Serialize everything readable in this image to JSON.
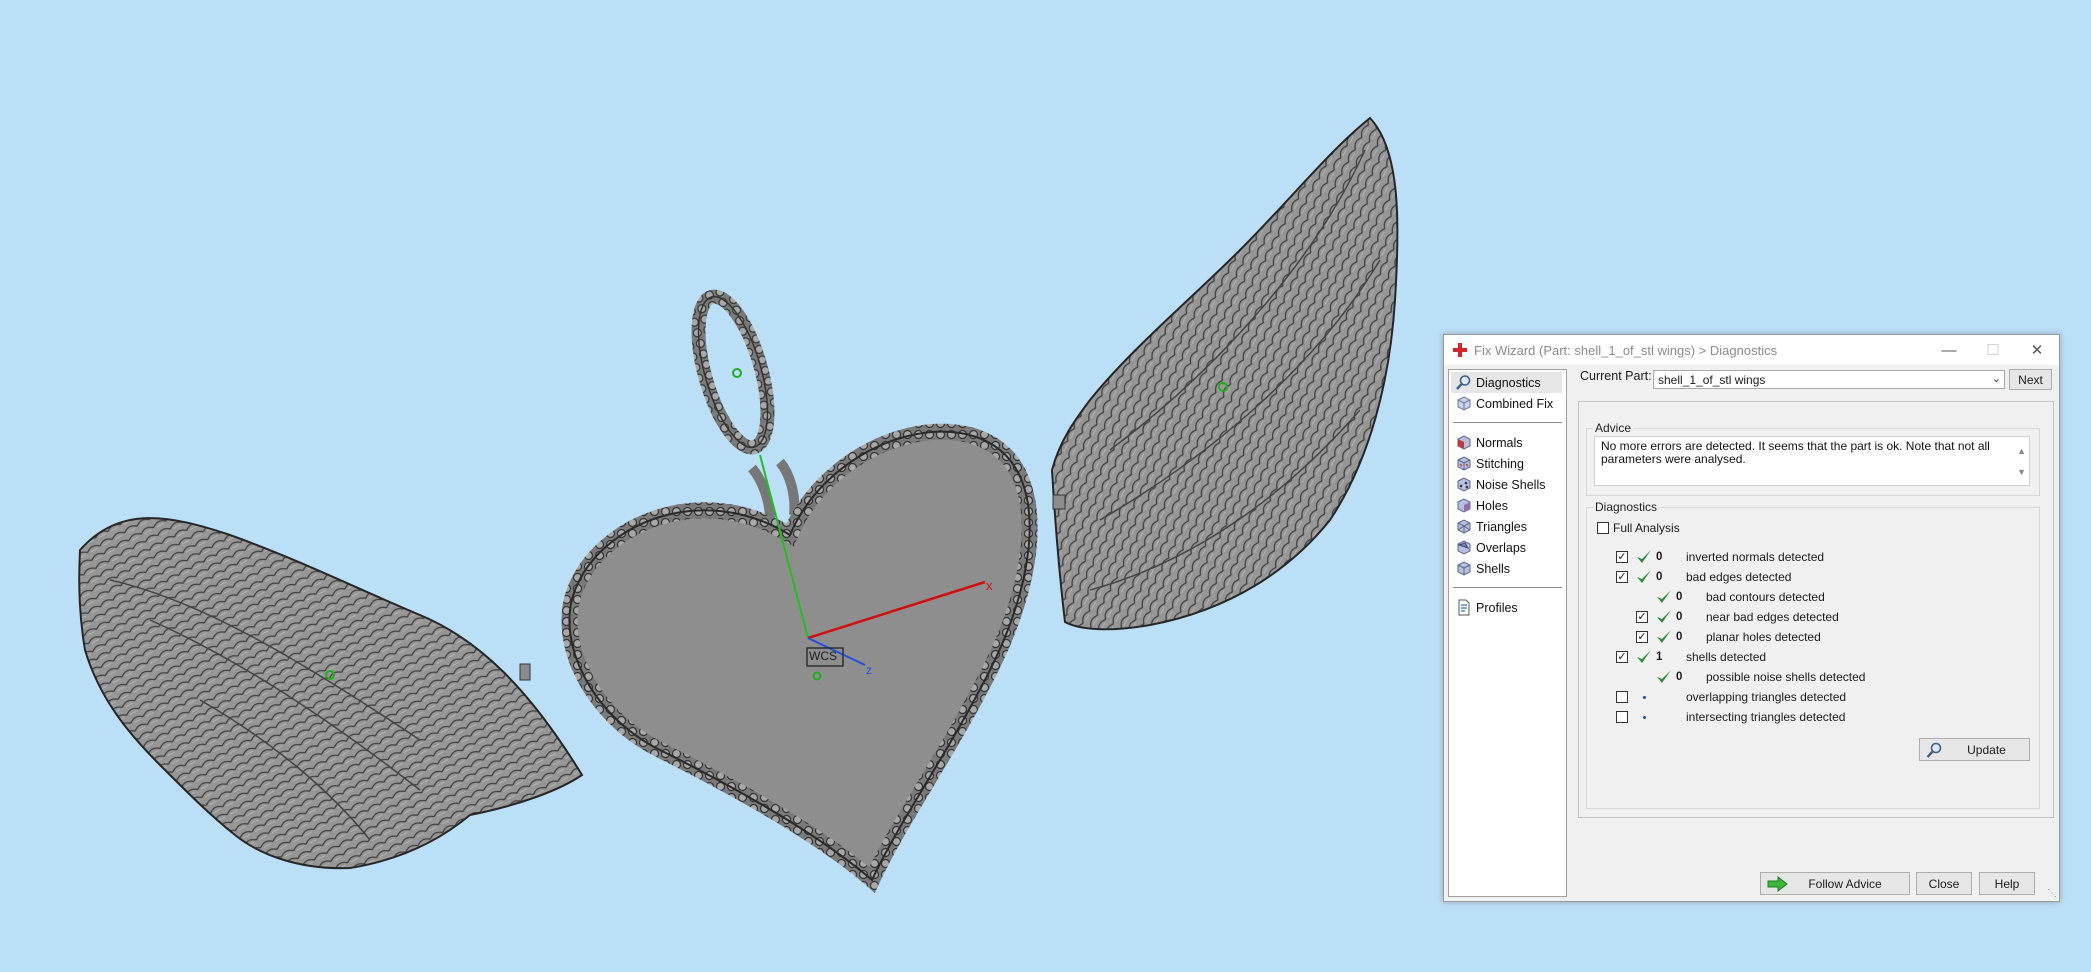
{
  "dialog": {
    "title": "Fix Wizard (Part: shell_1_of_stl wings) > Diagnostics",
    "window_controls": {
      "minimize": "—",
      "maximize": "☐",
      "close": "✕"
    },
    "sidebar": {
      "top_items": [
        {
          "label": "Diagnostics",
          "icon": "magnifier-icon"
        },
        {
          "label": "Combined Fix",
          "icon": "cube-icon"
        }
      ],
      "fix_items": [
        {
          "label": "Normals",
          "icon": "normals-cube-icon"
        },
        {
          "label": "Stitching",
          "icon": "stitching-cube-icon"
        },
        {
          "label": "Noise Shells",
          "icon": "noise-shells-icon"
        },
        {
          "label": "Holes",
          "icon": "holes-cube-icon"
        },
        {
          "label": "Triangles",
          "icon": "triangles-cube-icon"
        },
        {
          "label": "Overlaps",
          "icon": "overlaps-cube-icon"
        },
        {
          "label": "Shells",
          "icon": "shells-cube-icon"
        }
      ],
      "bottom_items": [
        {
          "label": "Profiles",
          "icon": "profiles-document-icon"
        }
      ]
    },
    "current_part_label": "Current Part:",
    "current_part_value": "shell_1_of_stl wings",
    "next_button": "Next",
    "advice_title": "Advice",
    "advice_text": "No more errors are detected. It seems that the part is ok. Note that not all parameters were analysed.",
    "diagnostics_title": "Diagnostics",
    "full_analysis_label": "Full Analysis",
    "full_analysis_checked": false,
    "rows": [
      {
        "checked": true,
        "status": "ok",
        "count": "0",
        "label": "inverted normals detected",
        "indent": 0,
        "has_checkbox": true
      },
      {
        "checked": true,
        "status": "ok",
        "count": "0",
        "label": "bad edges detected",
        "indent": 0,
        "has_checkbox": true
      },
      {
        "checked": false,
        "status": "ok",
        "count": "0",
        "label": "bad contours detected",
        "indent": 1,
        "has_checkbox": false
      },
      {
        "checked": true,
        "status": "ok",
        "count": "0",
        "label": "near bad edges detected",
        "indent": 1,
        "has_checkbox": true
      },
      {
        "checked": true,
        "status": "ok",
        "count": "0",
        "label": "planar holes detected",
        "indent": 1,
        "has_checkbox": true
      },
      {
        "checked": true,
        "status": "ok",
        "count": "1",
        "label": "shells detected",
        "indent": 0,
        "has_checkbox": true
      },
      {
        "checked": false,
        "status": "ok",
        "count": "0",
        "label": "possible noise shells detected",
        "indent": 1,
        "has_checkbox": false
      },
      {
        "checked": false,
        "status": "pending",
        "count": "",
        "label": "overlapping triangles detected",
        "indent": 0,
        "has_checkbox": true
      },
      {
        "checked": false,
        "status": "pending",
        "count": "",
        "label": "intersecting triangles detected",
        "indent": 0,
        "has_checkbox": true
      }
    ],
    "update_button": "Update",
    "follow_advice_button": "Follow Advice",
    "close_button": "Close",
    "help_button": "Help"
  },
  "viewport": {
    "axis_label_x": "x",
    "axis_label_z": "z",
    "wcs_label": "WCS",
    "colors": {
      "background": "#bcdff8",
      "model": "#8c8c8c",
      "x_axis": "#d01010",
      "y_axis": "#20c020",
      "z_axis": "#2050e0"
    }
  }
}
